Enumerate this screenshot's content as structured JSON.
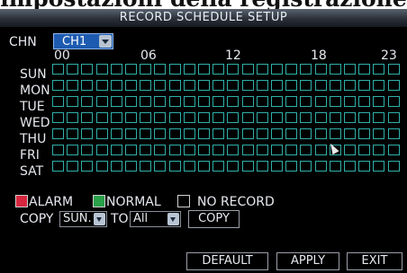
{
  "cropped_heading": "impostazioni della registrazione",
  "dialog": {
    "title": "RECORD SCHEDULE SETUP",
    "channel_label": "CHN",
    "channel_value": "CH1"
  },
  "grid": {
    "hour_labels": [
      "00",
      "06",
      "12",
      "18",
      "23"
    ],
    "days": [
      "SUN",
      "MON",
      "TUE",
      "WED",
      "THU",
      "FRI",
      "SAT"
    ],
    "cells_per_row": 24,
    "cell_border_color": "#2fb0a8"
  },
  "legend": {
    "alarm": "ALARM",
    "alarm_color": "#d6273f",
    "normal": "NORMAL",
    "normal_color": "#2aa04a",
    "no_record": "NO RECORD"
  },
  "copy": {
    "label": "COPY",
    "from_value": "SUN.",
    "to_label": "TO",
    "to_value": "All",
    "button": "COPY"
  },
  "buttons": {
    "default": "DEFAULT",
    "apply": "APPLY",
    "exit": "EXIT"
  }
}
